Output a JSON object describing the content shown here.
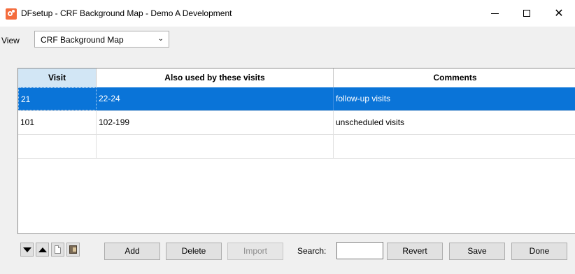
{
  "window": {
    "title": "DFsetup - CRF Background Map - Demo A Development",
    "minimize": "—",
    "maximize": "☐",
    "close": "✕"
  },
  "view": {
    "label": "View",
    "selected": "CRF Background Map",
    "arrow": "⌄"
  },
  "table": {
    "columns": [
      "Visit",
      "Also used by these visits",
      "Comments"
    ],
    "rows": [
      {
        "visit": "21",
        "also": "22-24",
        "comments": "follow-up visits",
        "selected": true
      },
      {
        "visit": "101",
        "also": "102-199",
        "comments": "unscheduled visits",
        "selected": false
      },
      {
        "visit": "",
        "also": "",
        "comments": "",
        "selected": false
      }
    ]
  },
  "toolbar": {
    "move_down_icon": "triangle-down-icon",
    "move_up_icon": "triangle-up-icon",
    "document_icon": "document-icon",
    "image_icon": "image-icon",
    "add_label": "Add",
    "delete_label": "Delete",
    "import_label": "Import",
    "search_label": "Search:",
    "search_value": "",
    "revert_label": "Revert",
    "save_label": "Save",
    "done_label": "Done"
  },
  "colors": {
    "selection": "#0a74d8",
    "header_highlight": "#d2e6f5",
    "app_icon": "#f46c3d"
  }
}
